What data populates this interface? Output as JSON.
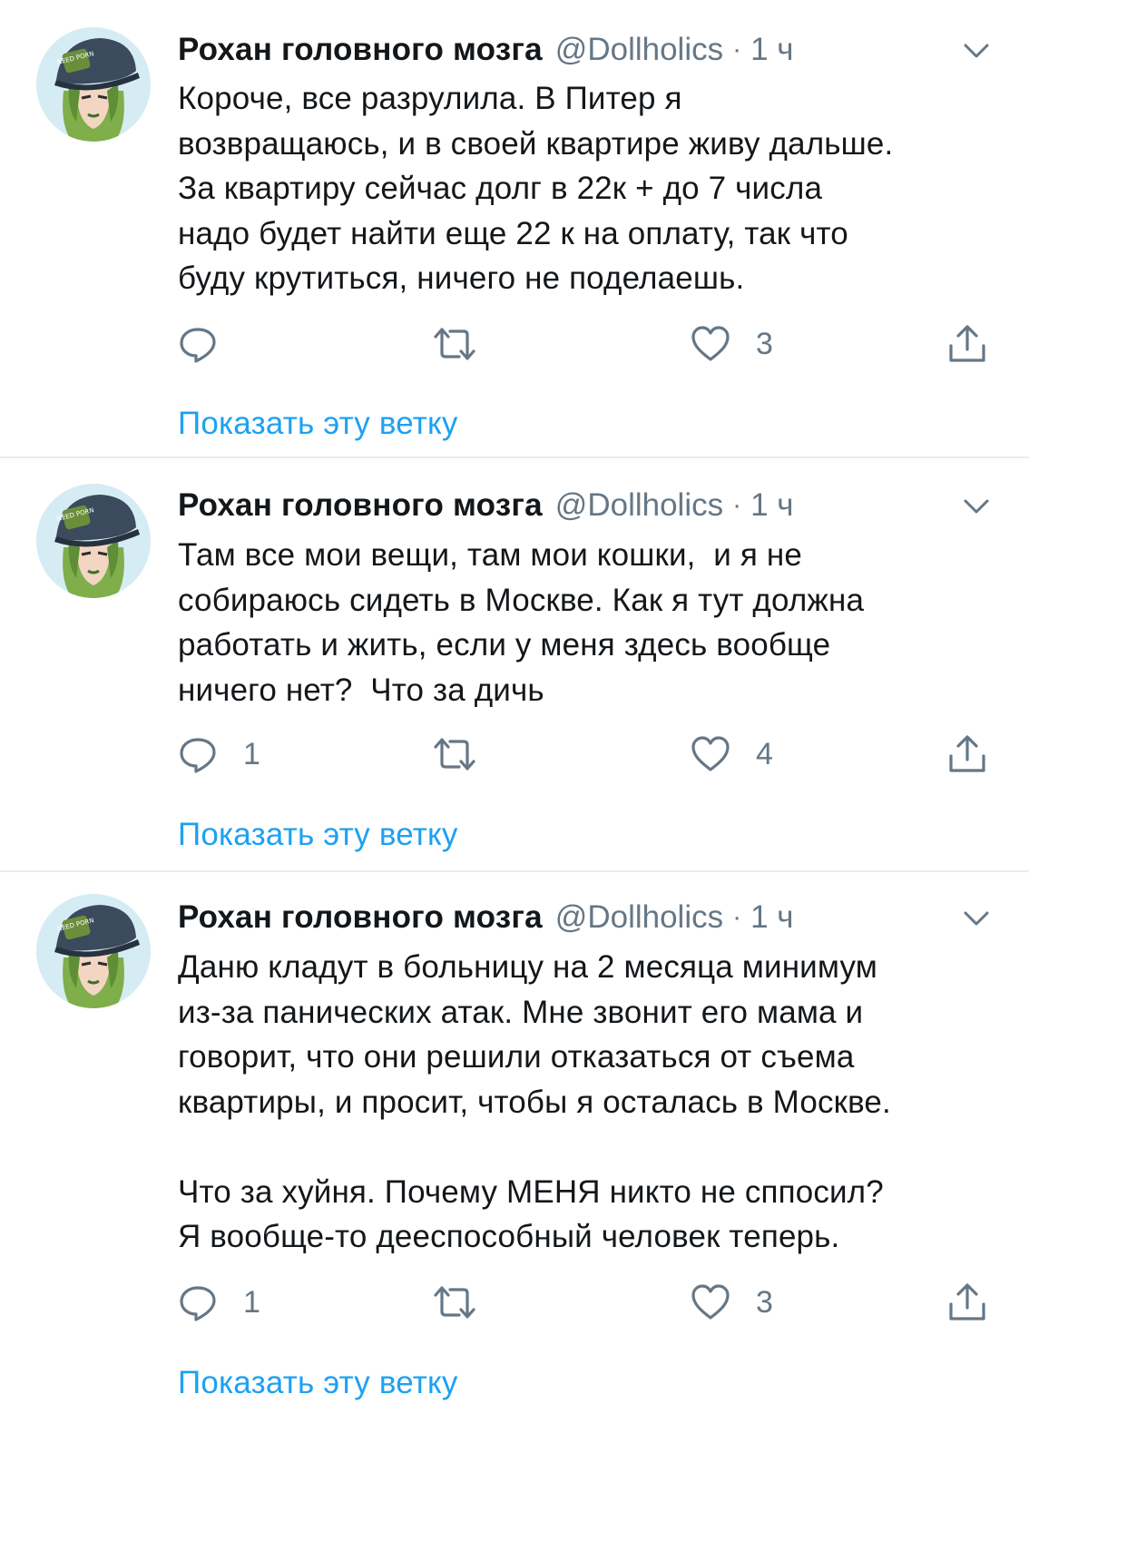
{
  "tweets": [
    {
      "author": {
        "name": "Рохан головного мозга",
        "handle": "@Dollholics",
        "avatar_cap_text": "NEED PORN"
      },
      "separator": "·",
      "time": "1 ч",
      "text": "Короче, все разрулила. В Питер я\nвозвращаюсь, и в своей квартире живу дальше.\nЗа квартиру сейчас долг в 22к + до 7 числа\nнадо будет найти еще 22 к на оплату, так что\nбуду крутиться, ничего не поделаешь.",
      "replies": "",
      "retweets": "",
      "likes": "3",
      "show_thread": "Показать эту ветку"
    },
    {
      "author": {
        "name": "Рохан головного мозга",
        "handle": "@Dollholics",
        "avatar_cap_text": "NEED PORN"
      },
      "separator": "·",
      "time": "1 ч",
      "text": "Там все мои вещи, там мои кошки,  и я не\nсобираюсь сидеть в Москве. Как я тут должна\nработать и жить, если у меня здесь вообще\nничего нет?  Что за дичь",
      "replies": "1",
      "retweets": "",
      "likes": "4",
      "show_thread": "Показать эту ветку"
    },
    {
      "author": {
        "name": "Рохан головного мозга",
        "handle": "@Dollholics",
        "avatar_cap_text": "NEED PORN"
      },
      "separator": "·",
      "time": "1 ч",
      "text": "Даню кладут в больницу на 2 месяца минимум\nиз-за панических атак. Мне звонит его мама и\nговорит, что они решили отказаться от съема\nквартиры, и просит, чтобы я осталась в Москве.\n\nЧто за хуйня. Почему МЕНЯ никто не сппосил?\nЯ вообще-то дееспособный человек теперь.",
      "replies": "1",
      "retweets": "",
      "likes": "3",
      "show_thread": "Показать эту ветку"
    }
  ],
  "icons": {
    "reply": "reply-icon",
    "retweet": "retweet-icon",
    "like": "heart-icon",
    "share": "share-icon",
    "caret": "chevron-down-icon"
  },
  "colors": {
    "text": "#14171a",
    "secondary": "#657786",
    "link": "#1da1f2",
    "divider": "#e6ecf0"
  }
}
